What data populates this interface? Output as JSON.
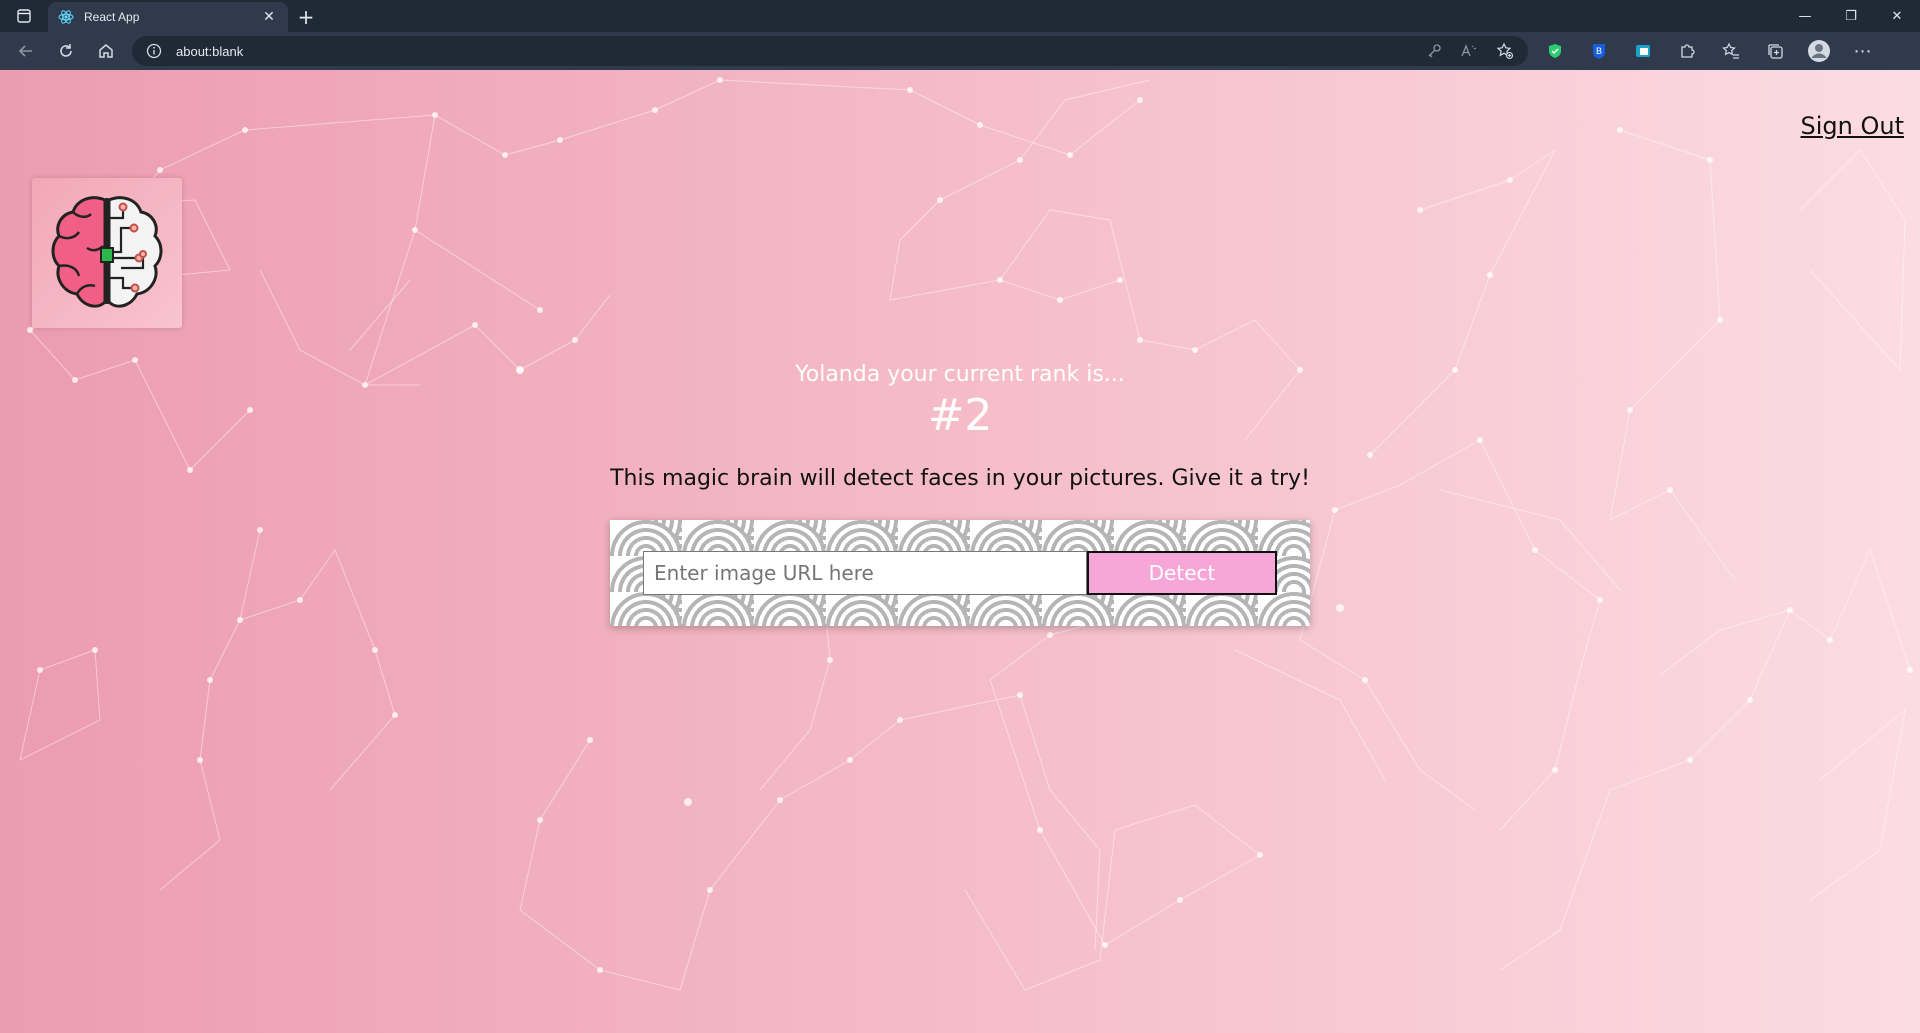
{
  "browser": {
    "tab": {
      "title": "React App"
    },
    "address_bar": {
      "url": "about:blank"
    },
    "icons": {
      "tab_actions": "tab-actions-icon",
      "back": "back-arrow-icon",
      "reload": "reload-icon",
      "home": "home-icon",
      "info": "info-icon",
      "key": "key-icon",
      "read_aloud": "read-aloud-icon",
      "favorite_add": "add-favorite-icon",
      "favorites": "favorites-icon",
      "collections": "collections-icon",
      "profile": "profile-icon",
      "more": "more-icon",
      "extensions": [
        "shield-extension-icon",
        "bitwarden-extension-icon",
        "translate-extension-icon",
        "puzzle-extensions-icon"
      ]
    }
  },
  "page": {
    "nav": {
      "sign_out": "Sign Out"
    },
    "rank": {
      "label": "Yolanda your current rank is...",
      "value": "#2"
    },
    "tagline": "This magic brain will detect faces in your pictures. Give it a try!",
    "form": {
      "input_placeholder": "Enter image URL here",
      "detect_label": "Detect"
    },
    "colors": {
      "gradient_start": "#ec9caf",
      "gradient_end": "#fcdce3",
      "detect_button": "#f6a7d8",
      "brain_pink": "#f25f86"
    }
  }
}
